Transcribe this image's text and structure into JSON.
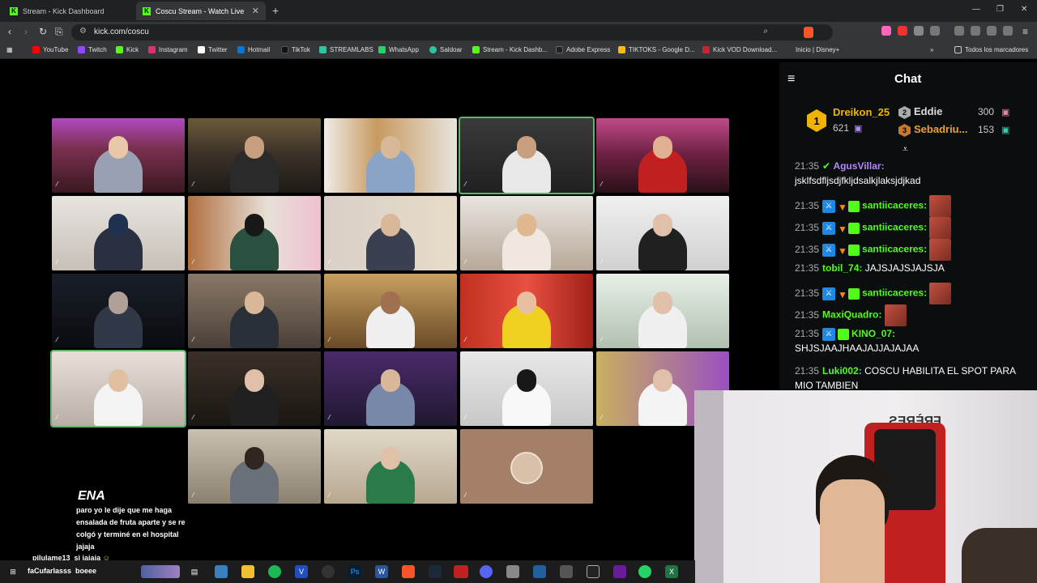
{
  "browser": {
    "tabs": [
      {
        "title": "Stream - Kick Dashboard"
      },
      {
        "title": "Coscu Stream - Watch Live on Kick",
        "active": true
      }
    ],
    "url": "kick.com/coscu"
  },
  "bookmarks": [
    "YouTube",
    "Twitch",
    "Kick",
    "Instagram",
    "Twitter",
    "Hotmail",
    "TikTok",
    "STREAMLABS",
    "WhatsApp",
    "Saldoar",
    "Stream - Kick Dashb...",
    "Adobe Express",
    "TIKTOKS - Google D...",
    "Kick VOD Download...",
    "Inicio | Disney+"
  ],
  "bookmarks_folder": "Todos los marcadores",
  "overlay": {
    "logo": "ENA",
    "message": "paro yo le dije que me haga ensalada de fruta aparte y se re colgó y terminé en el hospital jajaja",
    "line1_user": "pilulame13",
    "line1_text": "si jajaja",
    "line2_user": "faCufarlasss",
    "line2_text": "boeee"
  },
  "chat": {
    "title": "Chat",
    "leaderboard": {
      "first": {
        "rank": "1",
        "name": "Dreikon_25",
        "count": "621"
      },
      "second": {
        "rank": "2",
        "name": "Eddie",
        "count": "300"
      },
      "third": {
        "rank": "3",
        "name": "Sebadriu...",
        "count": "153"
      }
    },
    "messages": [
      {
        "time": "21:35",
        "user": "AgusVillar:",
        "text": "jsklfsdfljsdjfkljdsalkjlaksjdjkad",
        "color": "#b388ff"
      },
      {
        "time": "21:35",
        "user": "santiicaceres:",
        "text": "",
        "color": "#53fc18"
      },
      {
        "time": "21:35",
        "user": "santiicaceres:",
        "text": "",
        "color": "#53fc18"
      },
      {
        "time": "21:35",
        "user": "santiicaceres:",
        "text": "",
        "color": "#53fc18"
      },
      {
        "time": "21:35",
        "user": "tobil_74:",
        "text": "JAJSJAJSJAJSJA",
        "color": "#53fc18"
      },
      {
        "time": "21:35",
        "user": "santiicaceres:",
        "text": "",
        "color": "#53fc18"
      },
      {
        "time": "21:35",
        "user": "MaxiQuadro:",
        "text": "",
        "color": "#53fc18"
      },
      {
        "time": "21:35",
        "user": "KINO_07:",
        "text": "SHJSJAAJHAAJAJJAJAJAA",
        "color": "#53fc18"
      },
      {
        "time": "21:35",
        "user": "Luki002:",
        "text": "COSCU HABILITA EL SPOT PARA MIO TAMBIEN",
        "color": "#53fc18"
      }
    ]
  },
  "colors": {
    "accent": "#53fc18",
    "gold": "#f0b400"
  }
}
